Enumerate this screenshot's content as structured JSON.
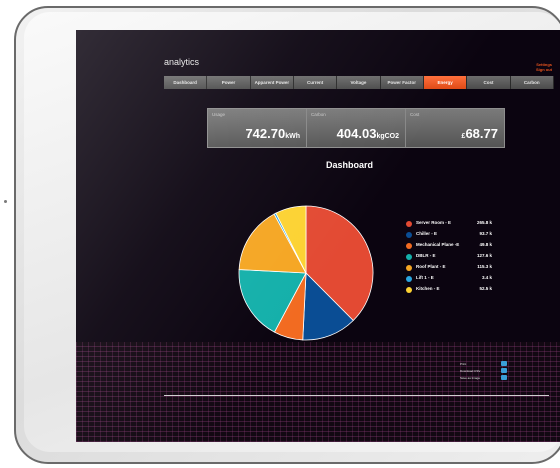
{
  "app": {
    "title": "analytics"
  },
  "top_links": [
    "Settings",
    "Sign out"
  ],
  "nav": [
    {
      "label": "Dashboard",
      "active": false
    },
    {
      "label": "Power",
      "active": false
    },
    {
      "label": "Apparent Power",
      "active": false
    },
    {
      "label": "Current",
      "active": false
    },
    {
      "label": "Voltage",
      "active": false
    },
    {
      "label": "Power Factor",
      "active": false
    },
    {
      "label": "Energy",
      "active": true
    },
    {
      "label": "Cost",
      "active": false
    },
    {
      "label": "Carbon",
      "active": false
    }
  ],
  "stats": {
    "usage": {
      "label": "Usage",
      "value": "742.70",
      "unit": "kWh"
    },
    "carbon": {
      "label": "Carbon",
      "value": "404.03",
      "unit": "kgCO2"
    },
    "cost": {
      "label": "Cost",
      "currency": "£",
      "value": "68.77"
    }
  },
  "dashboard": {
    "title": "Dashboard"
  },
  "chart_data": {
    "type": "pie",
    "title": "Dashboard",
    "legend_position": "right",
    "slices": [
      {
        "label": "Server Room - E",
        "display": "265.8 k",
        "value": 265.8,
        "color": "#e34a33"
      },
      {
        "label": "Chiller - E",
        "display": "93.7 k",
        "value": 93.7,
        "color": "#0a4d94"
      },
      {
        "label": "Mechanical Plane -E",
        "display": "49.8 k",
        "value": 49.8,
        "color": "#f26b21"
      },
      {
        "label": "DBLR - E",
        "display": "127.6 k",
        "value": 127.6,
        "color": "#14b0aa"
      },
      {
        "label": "Roof Plant - E",
        "display": "115.3 k",
        "value": 115.3,
        "color": "#f5a623"
      },
      {
        "label": "Lift 1 - E",
        "display": "3.4 k",
        "value": 3.4,
        "color": "#2aa6e0"
      },
      {
        "label": "Kitchen - E",
        "display": "52.5 k",
        "value": 52.5,
        "color": "#fcd232"
      }
    ]
  },
  "actions": [
    {
      "label": "Print"
    },
    {
      "label": "Download CSV"
    },
    {
      "label": "Save as Image"
    }
  ]
}
